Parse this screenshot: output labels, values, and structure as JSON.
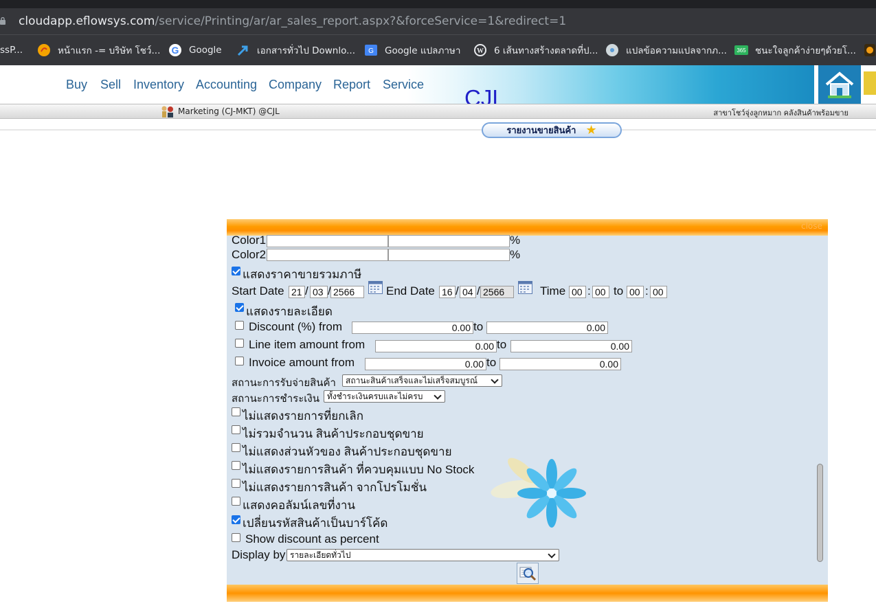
{
  "browser": {
    "url_host": "cloudapp.eflowsys.com",
    "url_path": "/service/Printing/ar/ar_sales_report.aspx?&forceService=1&redirect=1",
    "bookmarks": [
      {
        "label": "ssP...",
        "icon": "generic-site-icon"
      },
      {
        "label": "หน้าแรก -= บริษัท โชว์...",
        "icon": "site-logo-icon"
      },
      {
        "label": "Google",
        "icon": "google-icon"
      },
      {
        "label": "เอกสารทั่วไป Downlo...",
        "icon": "arrow-icon"
      },
      {
        "label": "Google แปลภาษา",
        "icon": "google-translate-icon"
      },
      {
        "label": "6 เส้นทางสร้างตลาดที่ป...",
        "icon": "wordpress-icon"
      },
      {
        "label": "แปลข้อความแปลจากภ...",
        "icon": "disc-icon"
      },
      {
        "label": "ชนะใจลูกค้าง่ายๆด้วยโ...",
        "icon": "365-icon"
      }
    ]
  },
  "nav": {
    "items": [
      "Buy",
      "Sell",
      "Inventory",
      "Accounting",
      "Company",
      "Report",
      "Service"
    ],
    "company": "CJL"
  },
  "user": {
    "info": "Marketing (CJ-MKT) @CJL",
    "branch": "สาขาโชว์จุ่งลูกหมาก  คลังสินค้าพร้อมขาย"
  },
  "page_title": "รายงานขายสินค้า",
  "dialog": {
    "close": "close",
    "color1_label": "Color1",
    "color2_label": "Color2",
    "percent": "%",
    "show_price_incl_vat": {
      "label": "แสดงราคาขายรวมภาษี",
      "checked": true
    },
    "start_date_label": "Start Date",
    "start_date": {
      "d": "21",
      "m": "03",
      "y": "2566"
    },
    "end_date_label": "End Date",
    "end_date": {
      "d": "16",
      "m": "04",
      "y": "2566"
    },
    "time_label": "Time",
    "time_from": {
      "h": "00",
      "m": "00"
    },
    "to_label": "to",
    "time_to": {
      "h": "00",
      "m": "00"
    },
    "colon": ":",
    "slash": "/",
    "show_detail": {
      "label": "แสดงรายละเอียด",
      "checked": true
    },
    "discount": {
      "label": "Discount (%) from",
      "from": "0.00",
      "to": "0.00",
      "checked": false
    },
    "line_item": {
      "label": "Line item amount from",
      "from": "0.00",
      "to": "0.00",
      "checked": false
    },
    "invoice": {
      "label": "Invoice amount from",
      "from": "0.00",
      "to": "0.00",
      "checked": false
    },
    "stock_status_label": "สถานะการรับจ่ายสินค้า",
    "stock_status_value": "สถานะสินค้าเสร็จและไม่เสร็จสมบูรณ์",
    "payment_status_label": "สถานะการชำระเงิน",
    "payment_status_value": "ทั้งชำระเงินครบและไม่ครบ",
    "options": [
      {
        "label": "ไม่แสดงรายการที่ยกเลิก",
        "checked": false
      },
      {
        "label": "ไม่รวมจำนวน สินค้าประกอบชุดขาย",
        "checked": false
      },
      {
        "label": "ไม่แสดงส่วนหัวของ สินค้าประกอบชุดขาย",
        "checked": false
      },
      {
        "label": "ไม่แสดงรายการสินค้า ที่ควบคุมแบบ No Stock",
        "checked": false
      },
      {
        "label": "ไม่แสดงรายการสินค้า จากโปรโมชั่น",
        "checked": false
      },
      {
        "label": "แสดงคอลัมน์เลขที่งาน",
        "checked": false
      },
      {
        "label": "เปลี่ยนรหัสสินค้าเป็นบาร์โค้ด",
        "checked": true
      }
    ],
    "show_discount_percent": {
      "label": "Show discount as percent",
      "checked": false
    },
    "display_by_label": "Display by",
    "display_by_value": "รายละเอียดทั่วไป"
  },
  "colors": {
    "accent_orange": "#ff9c00",
    "nav_link": "#2a6496",
    "company": "#2020c8",
    "dialog_bg": "#d9e4ef"
  }
}
